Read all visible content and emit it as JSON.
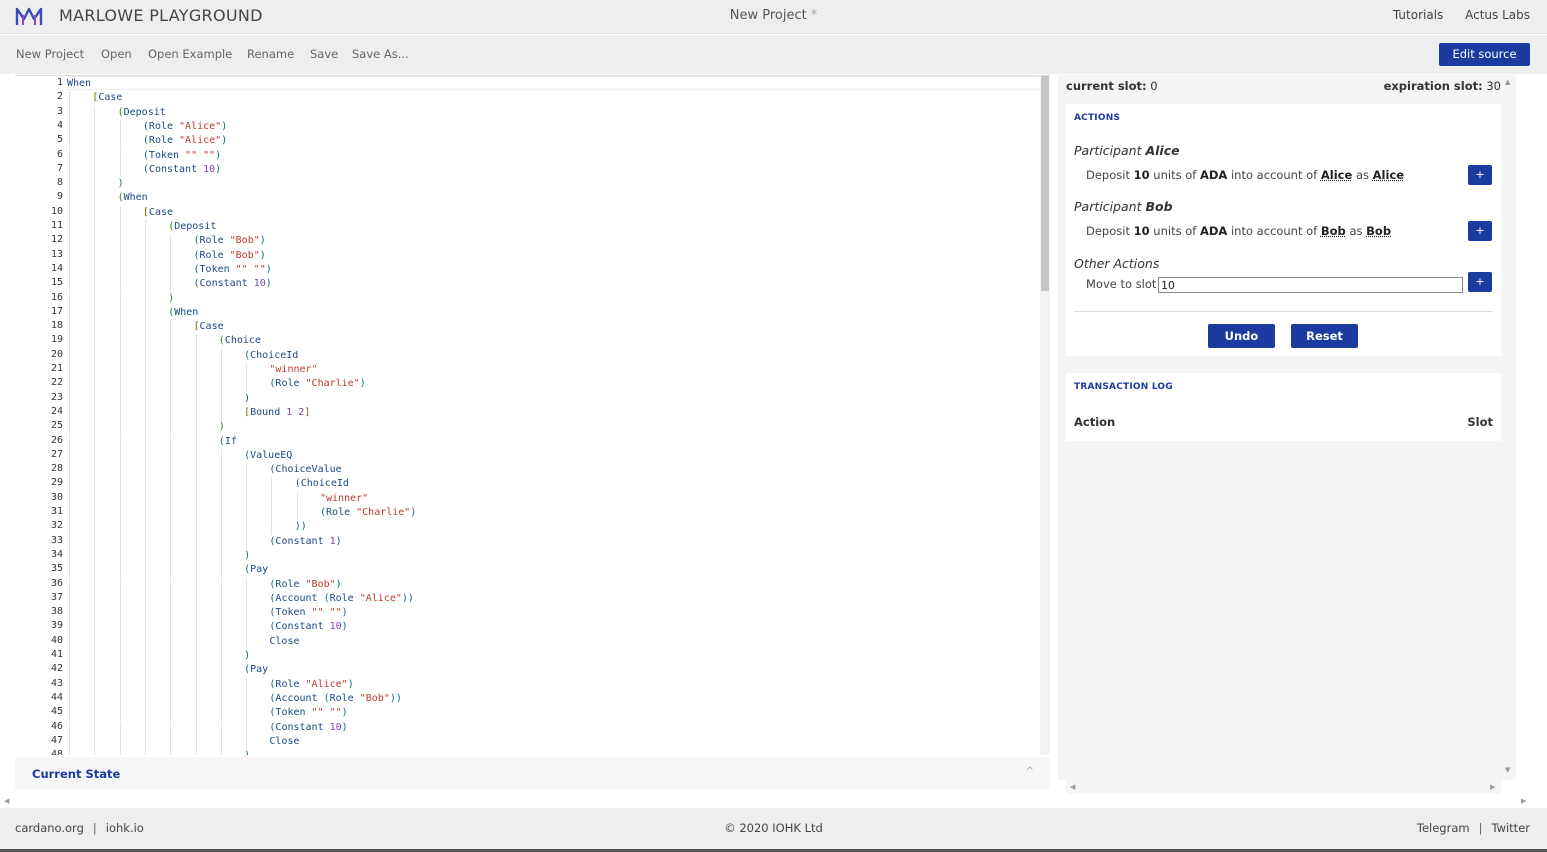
{
  "header": {
    "brand": "MARLOWE PLAYGROUND",
    "project_title": "New Project",
    "unsaved_marker": "*",
    "links": [
      "Tutorials",
      "Actus Labs"
    ]
  },
  "menu": {
    "items": [
      "New Project",
      "Open",
      "Open Example",
      "Rename",
      "Save",
      "Save As..."
    ],
    "edit_source": "Edit source"
  },
  "editor": {
    "lines": [
      {
        "i": 0,
        "t": [
          [
            "kw",
            "When"
          ]
        ]
      },
      {
        "i": 1,
        "t": [
          [
            "p2",
            "["
          ],
          [
            "kw",
            "Case"
          ]
        ]
      },
      {
        "i": 2,
        "t": [
          [
            "p0",
            "("
          ],
          [
            "kw",
            "Deposit"
          ]
        ]
      },
      {
        "i": 3,
        "t": [
          [
            "p1",
            "("
          ],
          [
            "kw",
            "Role "
          ],
          [
            "str",
            "\"Alice\""
          ],
          [
            "p1",
            ")"
          ]
        ]
      },
      {
        "i": 3,
        "t": [
          [
            "p1",
            "("
          ],
          [
            "kw",
            "Role "
          ],
          [
            "str",
            "\"Alice\""
          ],
          [
            "p1",
            ")"
          ]
        ]
      },
      {
        "i": 3,
        "t": [
          [
            "p1",
            "("
          ],
          [
            "kw",
            "Token "
          ],
          [
            "str",
            "\"\" \"\""
          ],
          [
            "p1",
            ")"
          ]
        ]
      },
      {
        "i": 3,
        "t": [
          [
            "p1",
            "("
          ],
          [
            "kw",
            "Constant "
          ],
          [
            "num",
            "10"
          ],
          [
            "p1",
            ")"
          ]
        ]
      },
      {
        "i": 2,
        "t": [
          [
            "p0",
            ")"
          ]
        ]
      },
      {
        "i": 2,
        "t": [
          [
            "p0",
            "("
          ],
          [
            "kw",
            "When"
          ]
        ]
      },
      {
        "i": 3,
        "t": [
          [
            "p2",
            "["
          ],
          [
            "kw",
            "Case"
          ]
        ]
      },
      {
        "i": 4,
        "t": [
          [
            "p0",
            "("
          ],
          [
            "kw",
            "Deposit"
          ]
        ]
      },
      {
        "i": 5,
        "t": [
          [
            "p1",
            "("
          ],
          [
            "kw",
            "Role "
          ],
          [
            "str",
            "\"Bob\""
          ],
          [
            "p1",
            ")"
          ]
        ]
      },
      {
        "i": 5,
        "t": [
          [
            "p1",
            "("
          ],
          [
            "kw",
            "Role "
          ],
          [
            "str",
            "\"Bob\""
          ],
          [
            "p1",
            ")"
          ]
        ]
      },
      {
        "i": 5,
        "t": [
          [
            "p1",
            "("
          ],
          [
            "kw",
            "Token "
          ],
          [
            "str",
            "\"\" \"\""
          ],
          [
            "p1",
            ")"
          ]
        ]
      },
      {
        "i": 5,
        "t": [
          [
            "p1",
            "("
          ],
          [
            "kw",
            "Constant "
          ],
          [
            "num",
            "10"
          ],
          [
            "p1",
            ")"
          ]
        ]
      },
      {
        "i": 4,
        "t": [
          [
            "p0",
            ")"
          ]
        ]
      },
      {
        "i": 4,
        "t": [
          [
            "p0",
            "("
          ],
          [
            "kw",
            "When"
          ]
        ]
      },
      {
        "i": 5,
        "t": [
          [
            "p2",
            "["
          ],
          [
            "kw",
            "Case"
          ]
        ]
      },
      {
        "i": 6,
        "t": [
          [
            "p0",
            "("
          ],
          [
            "kw",
            "Choice"
          ]
        ]
      },
      {
        "i": 7,
        "t": [
          [
            "p1",
            "("
          ],
          [
            "kw",
            "ChoiceId"
          ]
        ]
      },
      {
        "i": 8,
        "t": [
          [
            "str",
            "\"winner\""
          ]
        ]
      },
      {
        "i": 8,
        "t": [
          [
            "p1",
            "("
          ],
          [
            "kw",
            "Role "
          ],
          [
            "str",
            "\"Charlie\""
          ],
          [
            "p1",
            ")"
          ]
        ]
      },
      {
        "i": 7,
        "t": [
          [
            "p1",
            ")"
          ]
        ]
      },
      {
        "i": 7,
        "t": [
          [
            "p2",
            "["
          ],
          [
            "kw",
            "Bound "
          ],
          [
            "num",
            "1 2"
          ],
          [
            "p2",
            "]"
          ]
        ]
      },
      {
        "i": 6,
        "t": [
          [
            "p0",
            ")"
          ]
        ]
      },
      {
        "i": 6,
        "t": [
          [
            "p0",
            "("
          ],
          [
            "kw",
            "If"
          ]
        ]
      },
      {
        "i": 7,
        "t": [
          [
            "p1",
            "("
          ],
          [
            "kw",
            "ValueEQ"
          ]
        ]
      },
      {
        "i": 8,
        "t": [
          [
            "p1",
            "("
          ],
          [
            "kw",
            "ChoiceValue"
          ]
        ]
      },
      {
        "i": 9,
        "t": [
          [
            "p1",
            "("
          ],
          [
            "kw",
            "ChoiceId"
          ]
        ]
      },
      {
        "i": 10,
        "t": [
          [
            "str",
            "\"winner\""
          ]
        ]
      },
      {
        "i": 10,
        "t": [
          [
            "p1",
            "("
          ],
          [
            "kw",
            "Role "
          ],
          [
            "str",
            "\"Charlie\""
          ],
          [
            "p1",
            ")"
          ]
        ]
      },
      {
        "i": 9,
        "t": [
          [
            "p1",
            "))"
          ]
        ]
      },
      {
        "i": 8,
        "t": [
          [
            "p1",
            "("
          ],
          [
            "kw",
            "Constant "
          ],
          [
            "num",
            "1"
          ],
          [
            "p1",
            ")"
          ]
        ]
      },
      {
        "i": 7,
        "t": [
          [
            "p1",
            ")"
          ]
        ]
      },
      {
        "i": 7,
        "t": [
          [
            "p1",
            "("
          ],
          [
            "kw",
            "Pay"
          ]
        ]
      },
      {
        "i": 8,
        "t": [
          [
            "p1",
            "("
          ],
          [
            "kw",
            "Role "
          ],
          [
            "str",
            "\"Bob\""
          ],
          [
            "p1",
            ")"
          ]
        ]
      },
      {
        "i": 8,
        "t": [
          [
            "p1",
            "("
          ],
          [
            "kw",
            "Account "
          ],
          [
            "p1",
            "("
          ],
          [
            "kw",
            "Role "
          ],
          [
            "str",
            "\"Alice\""
          ],
          [
            "p1",
            "))"
          ]
        ]
      },
      {
        "i": 8,
        "t": [
          [
            "p1",
            "("
          ],
          [
            "kw",
            "Token "
          ],
          [
            "str",
            "\"\" \"\""
          ],
          [
            "p1",
            ")"
          ]
        ]
      },
      {
        "i": 8,
        "t": [
          [
            "p1",
            "("
          ],
          [
            "kw",
            "Constant "
          ],
          [
            "num",
            "10"
          ],
          [
            "p1",
            ")"
          ]
        ]
      },
      {
        "i": 8,
        "t": [
          [
            "kw",
            "Close"
          ]
        ]
      },
      {
        "i": 7,
        "t": [
          [
            "p1",
            ")"
          ]
        ]
      },
      {
        "i": 7,
        "t": [
          [
            "p1",
            "("
          ],
          [
            "kw",
            "Pay"
          ]
        ]
      },
      {
        "i": 8,
        "t": [
          [
            "p1",
            "("
          ],
          [
            "kw",
            "Role "
          ],
          [
            "str",
            "\"Alice\""
          ],
          [
            "p1",
            ")"
          ]
        ]
      },
      {
        "i": 8,
        "t": [
          [
            "p1",
            "("
          ],
          [
            "kw",
            "Account "
          ],
          [
            "p1",
            "("
          ],
          [
            "kw",
            "Role "
          ],
          [
            "str",
            "\"Bob\""
          ],
          [
            "p1",
            "))"
          ]
        ]
      },
      {
        "i": 8,
        "t": [
          [
            "p1",
            "("
          ],
          [
            "kw",
            "Token "
          ],
          [
            "str",
            "\"\" \"\""
          ],
          [
            "p1",
            ")"
          ]
        ]
      },
      {
        "i": 8,
        "t": [
          [
            "p1",
            "("
          ],
          [
            "kw",
            "Constant "
          ],
          [
            "num",
            "10"
          ],
          [
            "p1",
            ")"
          ]
        ]
      },
      {
        "i": 8,
        "t": [
          [
            "kw",
            "Close"
          ]
        ]
      },
      {
        "i": 7,
        "t": [
          [
            "p1",
            ")"
          ]
        ]
      }
    ]
  },
  "current_state": {
    "label": "Current State",
    "toggle_glyph": "^"
  },
  "simulation": {
    "current_slot_label": "current slot:",
    "current_slot": "0",
    "expiration_slot_label": "expiration slot:",
    "expiration_slot": "30",
    "actions_title": "ACTIONS",
    "participant_word": "Participant",
    "participants": [
      {
        "name": "Alice",
        "action": {
          "verb": "Deposit",
          "amount": "10",
          "units_word": "units of",
          "token": "ADA",
          "into": "into account of",
          "account": "Alice",
          "as": "as",
          "party": "Alice"
        }
      },
      {
        "name": "Bob",
        "action": {
          "verb": "Deposit",
          "amount": "10",
          "units_word": "units of",
          "token": "ADA",
          "into": "into account of",
          "account": "Bob",
          "as": "as",
          "party": "Bob"
        }
      }
    ],
    "other_actions_title": "Other Actions",
    "move_to_slot_label": "Move to slot",
    "move_to_slot_value": "10",
    "plus_label": "+",
    "undo_label": "Undo",
    "reset_label": "Reset",
    "log_title": "TRANSACTION LOG",
    "log_columns": [
      "Action",
      "Slot"
    ]
  },
  "footer": {
    "left_links": [
      "cardano.org",
      "iohk.io"
    ],
    "copyright": "© 2020 IOHK Ltd",
    "right_links": [
      "Telegram",
      "Twitter"
    ],
    "separator": "|"
  },
  "colors": {
    "accent": "#1b3ba1",
    "keyword": "#1a4a86",
    "string": "#c0392b",
    "number": "#7b3fb5"
  }
}
